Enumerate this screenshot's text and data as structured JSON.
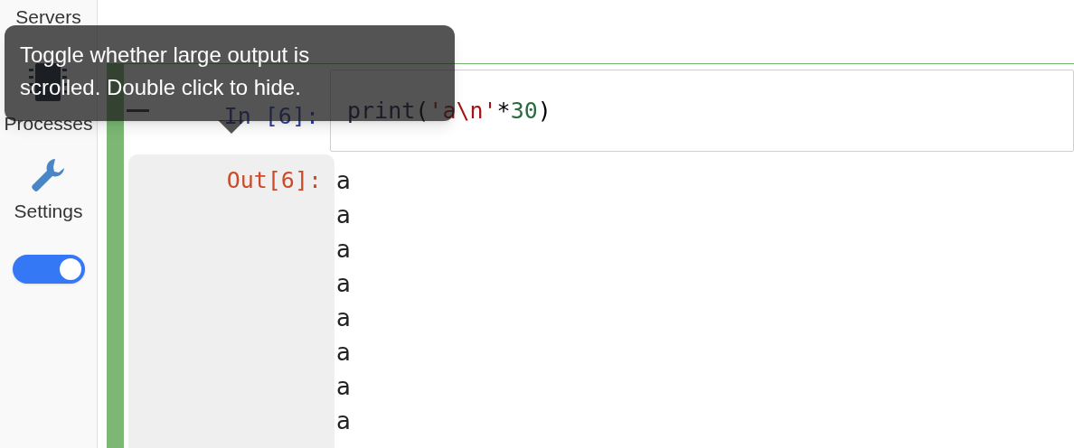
{
  "sidebar": {
    "items": [
      {
        "label": "Servers",
        "kind": "text"
      },
      {
        "label": "Processes",
        "kind": "chip"
      },
      {
        "label": "Settings",
        "kind": "wrench"
      }
    ],
    "toggle": {
      "on": true
    }
  },
  "cell": {
    "selected": true,
    "input_prompt": "In [6]:",
    "code": [
      {
        "text": "print",
        "kind": "builtin"
      },
      {
        "text": "(",
        "kind": "plain"
      },
      {
        "text": "'a\\n'",
        "kind": "string"
      },
      {
        "text": "*",
        "kind": "plain"
      },
      {
        "text": "30",
        "kind": "number"
      },
      {
        "text": ")",
        "kind": "plain"
      }
    ],
    "output_prompt": "Out[6]:",
    "output_lines": [
      "a",
      "a",
      "a",
      "a",
      "a",
      "a",
      "a",
      "a"
    ]
  },
  "tooltip": {
    "text": "Toggle whether large output is scrolled. Double click to hide."
  }
}
